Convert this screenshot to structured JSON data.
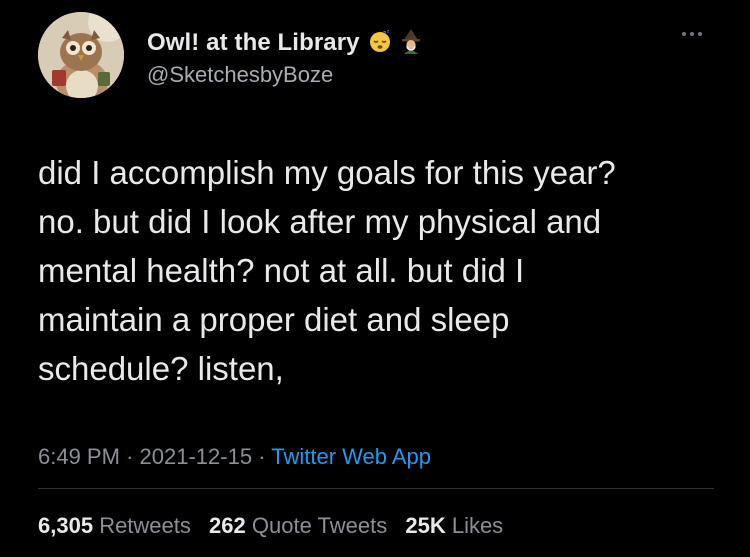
{
  "author": {
    "display_name": "Owl! at the Library",
    "handle": "@SketchesbyBoze",
    "name_emojis": [
      "sleeping-face-icon",
      "mage-icon"
    ]
  },
  "tweet": {
    "lines": [
      "did I accomplish my goals for this year?",
      "no. but did I look after my physical and",
      "mental health? not at all. but did I",
      "maintain a proper diet and sleep",
      "schedule? listen,"
    ],
    "time": "6:49 PM",
    "date": "2021-12-15",
    "separator": "·",
    "source": "Twitter Web App"
  },
  "stats": {
    "retweets_count": "6,305",
    "retweets_label": "Retweets",
    "quotes_count": "262",
    "quotes_label": "Quote Tweets",
    "likes_count": "25K",
    "likes_label": "Likes"
  },
  "colors": {
    "background": "#000000",
    "text_primary": "#e7e9ea",
    "text_secondary": "#8b9096",
    "link": "#1d9bf0",
    "divider": "#2f3336"
  }
}
